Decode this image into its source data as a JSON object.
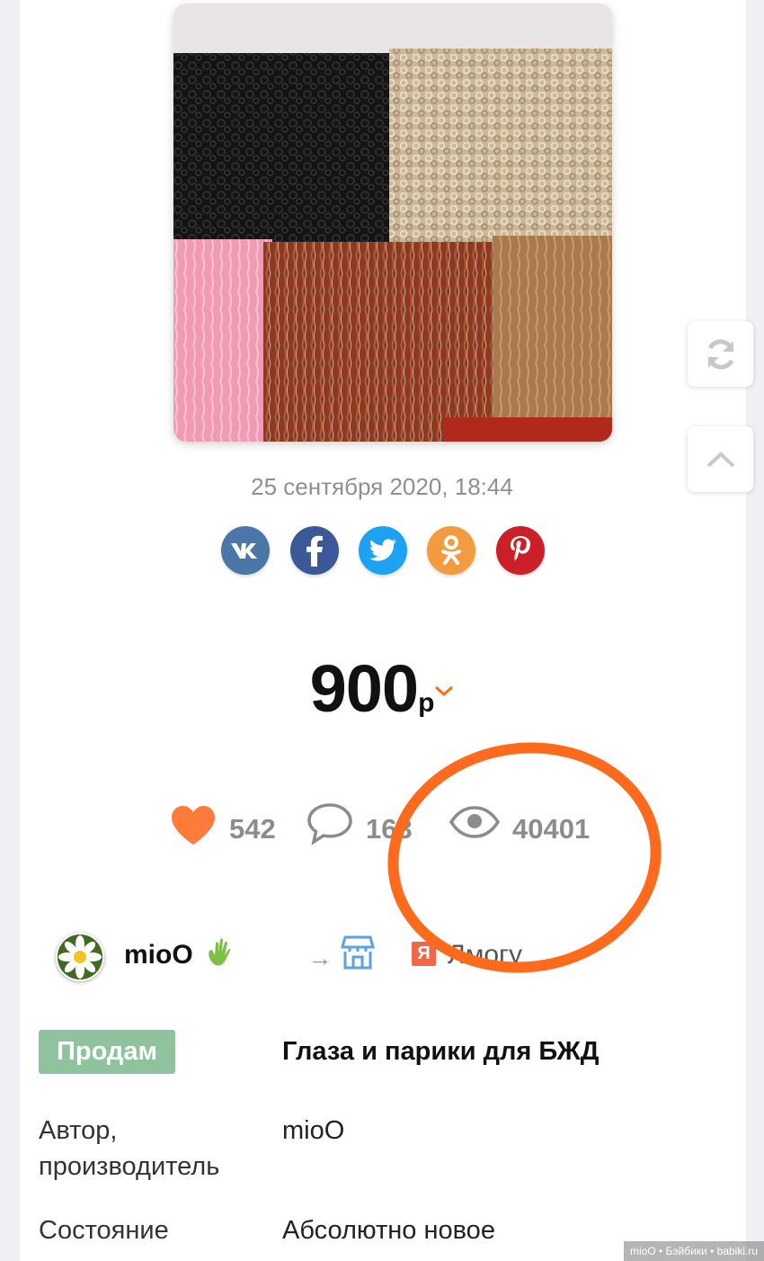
{
  "post": {
    "date": "25 сентября 2020, 18:44"
  },
  "share": [
    {
      "name": "vk",
      "color": "#4a76a8",
      "label": "VK"
    },
    {
      "name": "facebook",
      "color": "#3b5998",
      "label": "f"
    },
    {
      "name": "twitter",
      "color": "#1da1f2",
      "label": ""
    },
    {
      "name": "odnoklassniki",
      "color": "#f49a3f",
      "label": ""
    },
    {
      "name": "pinterest",
      "color": "#cb2027",
      "label": "P"
    }
  ],
  "price": {
    "value": "900",
    "currency": "р"
  },
  "stats": {
    "likes": "542",
    "comments": "163",
    "views": "40401"
  },
  "seller": {
    "name": "mioO",
    "arrow": "→",
    "ya_label": "Я",
    "ya_text": "Лмогу"
  },
  "listing": {
    "badge": "Продам",
    "title": "Глаза и парики для БЖД",
    "author_label": "Автор,\nпроизводитель",
    "author_label_line1": "Автор,",
    "author_label_line2": "производитель",
    "author_value": "mioO",
    "condition_label": "Состояние",
    "condition_value": "Абсолютно новое"
  },
  "watermark": "mioO • Бэйбики • babiki.ru",
  "colors": {
    "accent": "#ff6a1c",
    "heart": "#ff7b3a",
    "badge": "#8ec39d",
    "muted": "#8c8c8c"
  }
}
